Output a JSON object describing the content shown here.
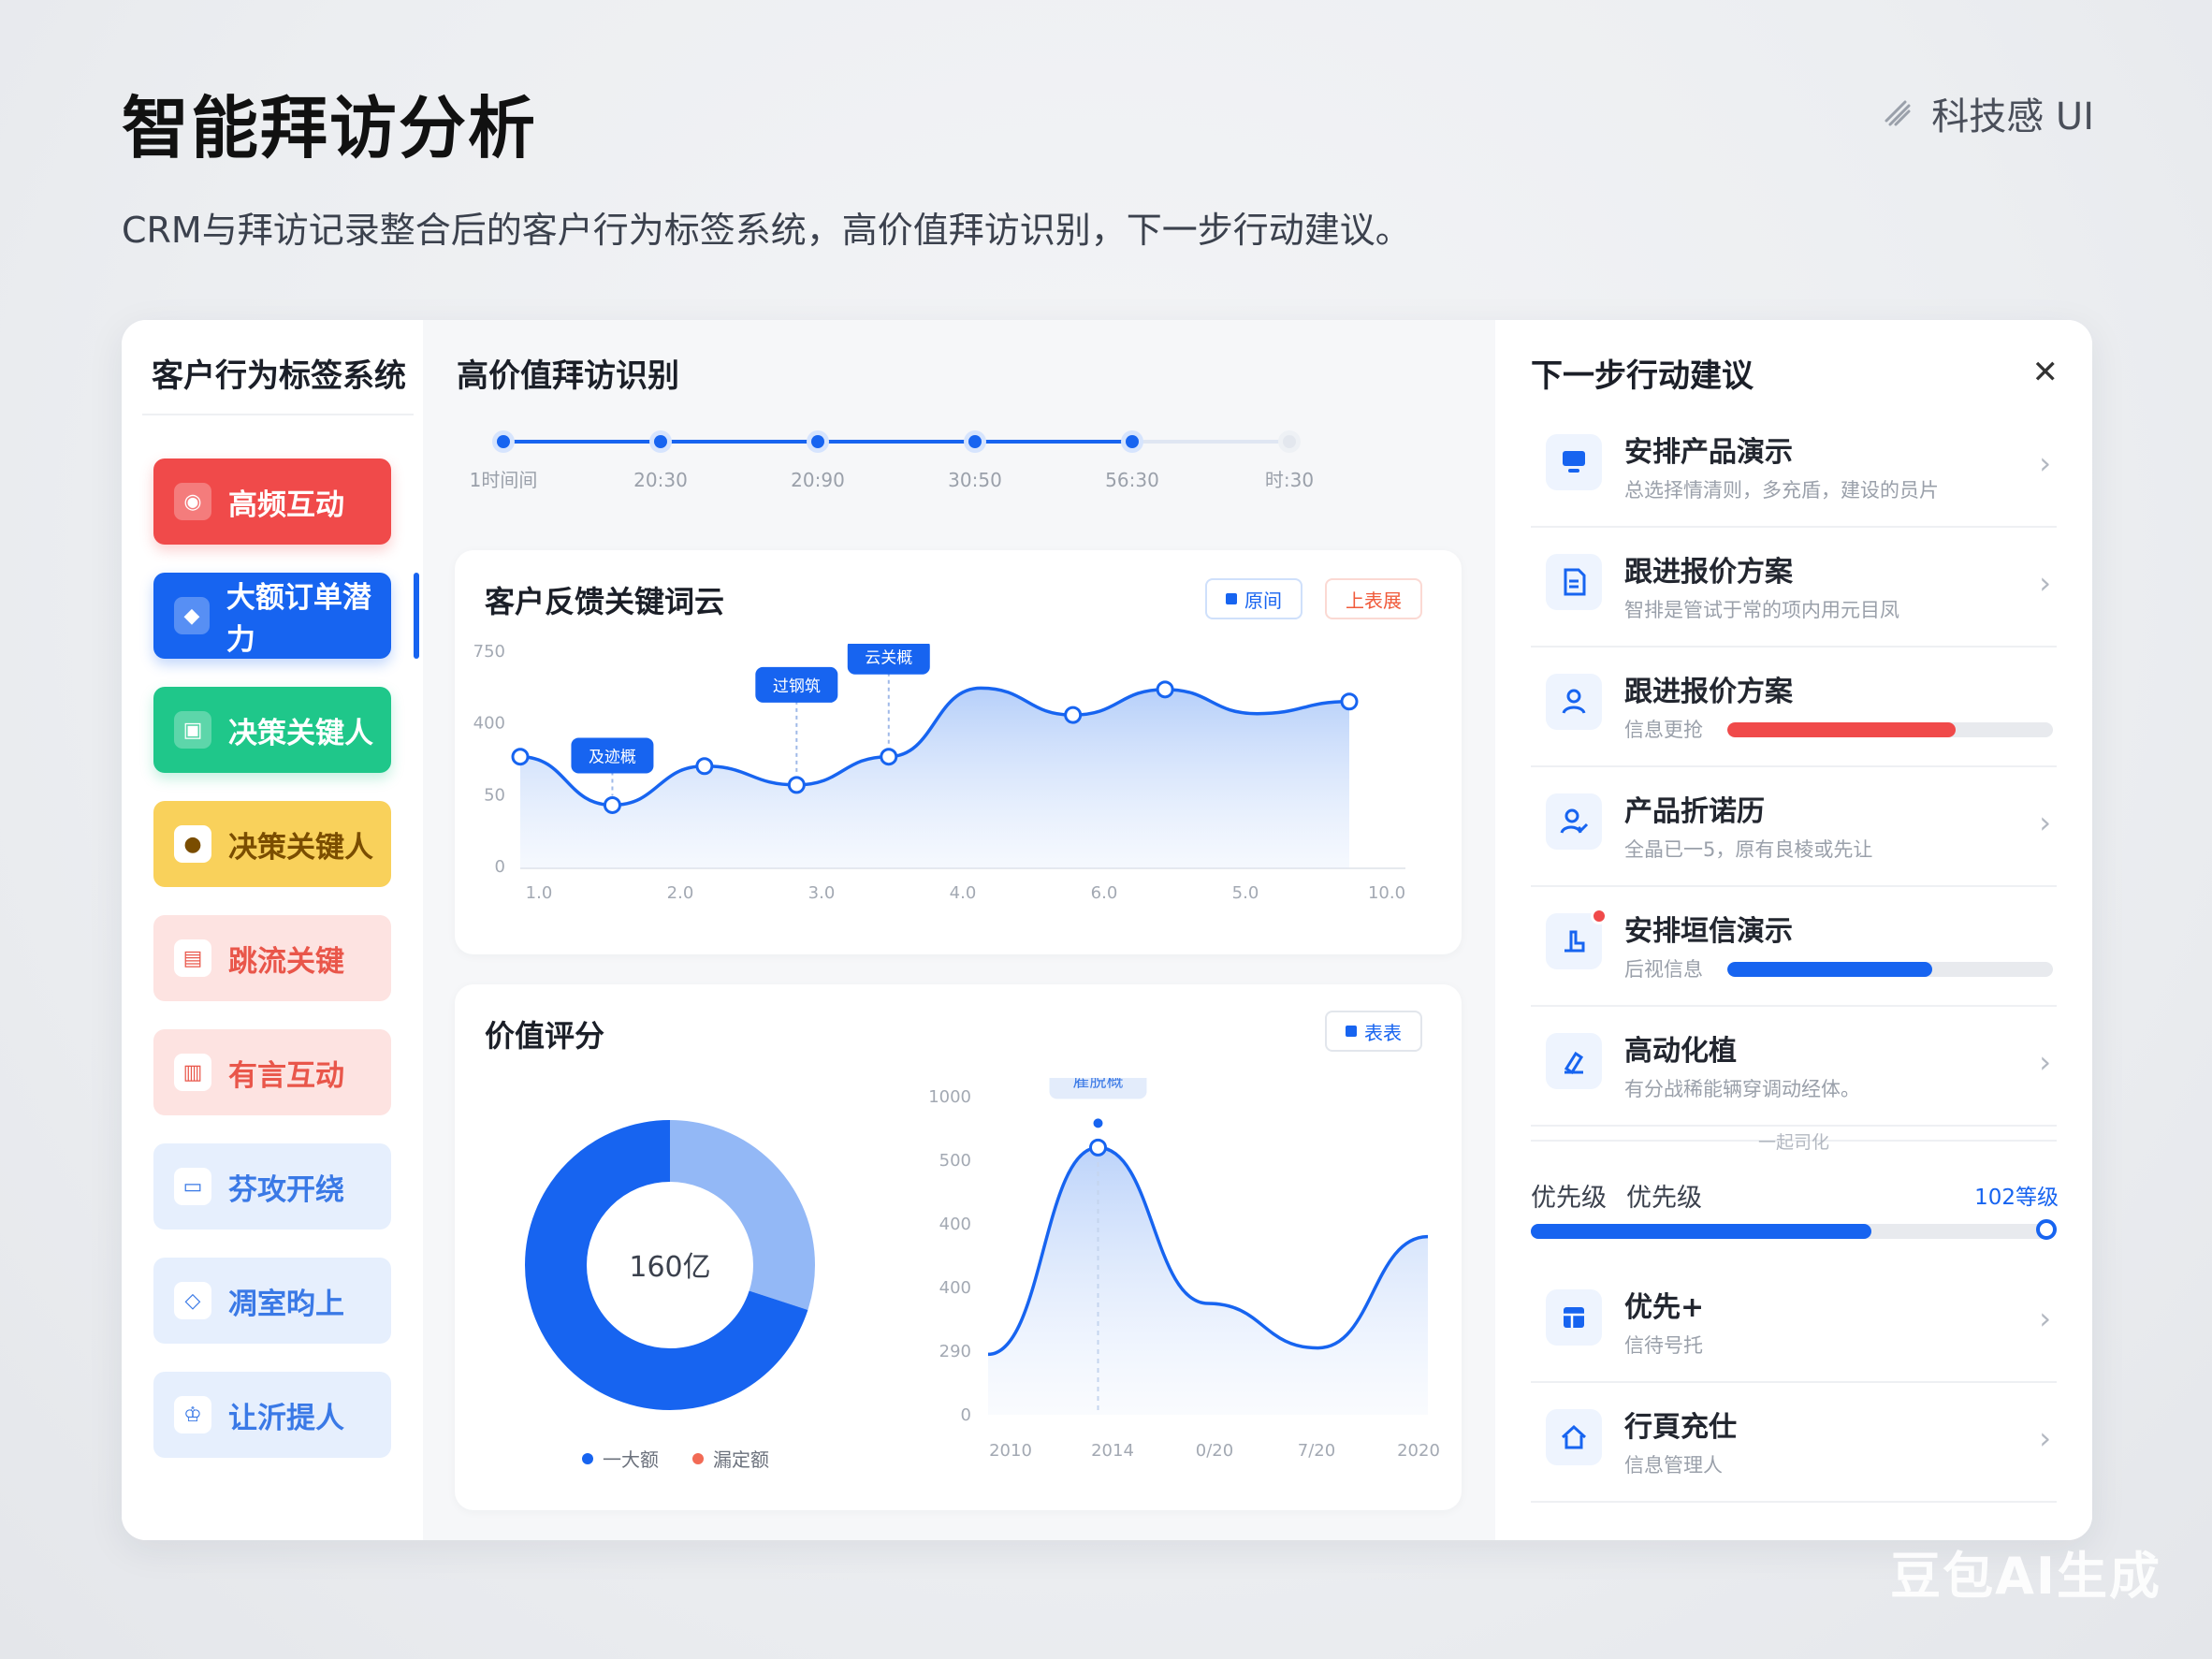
{
  "page": {
    "title": "智能拜访分析",
    "subtitle": "CRM与拜访记录整合后的客户行为标签系统，高价值拜访识别，下一步行动建议。",
    "brand": "科技感 UI",
    "watermark": "豆包AI生成"
  },
  "left": {
    "title": "客户行为标签系统",
    "tags": [
      {
        "label": "高频互动",
        "bg": "#f04a4a",
        "fg": "#ffffff"
      },
      {
        "label": "大额订单潜力",
        "bg": "#1764f0",
        "fg": "#ffffff",
        "active": true
      },
      {
        "label": "决策关键人",
        "bg": "#1fc78a",
        "fg": "#ffffff"
      },
      {
        "label": "决策关键人",
        "bg": "#f9d15b",
        "fg": "#7a4d00"
      },
      {
        "label": "跳流关键",
        "bg": "#fde3e1",
        "fg": "#e9564a"
      },
      {
        "label": "有言互动",
        "bg": "#fde3e1",
        "fg": "#e9564a"
      },
      {
        "label": "芬攻开绕",
        "bg": "#e6effd",
        "fg": "#3a79e6"
      },
      {
        "label": "凋室昀上",
        "bg": "#e6effd",
        "fg": "#3a79e6"
      },
      {
        "label": "让沂提人",
        "bg": "#e6effd",
        "fg": "#3a79e6"
      }
    ]
  },
  "middle": {
    "title": "高价值拜访识别",
    "timeline": {
      "labels": [
        "1时间间",
        "20:30",
        "20:90",
        "30:50",
        "56:30",
        "时:30"
      ],
      "active_count": 5
    },
    "keywords": {
      "title": "客户反馈关键词云",
      "chip_a": "原间",
      "chip_b": "上表展",
      "chart_data": {
        "type": "area",
        "x": [
          "1.0",
          "2.0",
          "3.0",
          "4.0",
          "6.0",
          "5.0",
          "10.0"
        ],
        "yticks": [
          "0",
          "50",
          "400",
          "750"
        ],
        "ylim": [
          0,
          800
        ],
        "values": [
          415,
          235,
          380,
          310,
          415,
          670,
          570,
          665,
          575,
          620
        ],
        "point_x": [
          0,
          0.165,
          0.358,
          0.5,
          0.6,
          0.745,
          0.86,
          1.0
        ],
        "callouts": [
          {
            "text": "及迹概",
            "point": 1
          },
          {
            "text": "过钢筑",
            "point": 2
          },
          {
            "text": "云关概",
            "point": 4
          }
        ],
        "line_color": "#1764f0"
      }
    },
    "value": {
      "title": "价值评分",
      "chip": "表表",
      "donut": {
        "center_label": "160亿",
        "segments": [
          {
            "name": "一大额",
            "value": 70,
            "color": "#1764f0"
          },
          {
            "name": "漏定额",
            "value": 30,
            "color": "#93b8f6"
          }
        ],
        "legend": [
          {
            "label": "一大额",
            "color": "#1764f0"
          },
          {
            "label": "漏定额",
            "color": "#f26a55"
          }
        ]
      },
      "chart_data": {
        "type": "area",
        "x": [
          "2010",
          "2014",
          "0/20",
          "7/20",
          "2020"
        ],
        "yticks": [
          "0",
          "290",
          "400",
          "400",
          "500",
          "1000"
        ],
        "ylim": [
          0,
          1000
        ],
        "values": [
          190,
          840,
          350,
          210,
          560
        ],
        "callout": "雇脱概",
        "line_color": "#1764f0"
      }
    }
  },
  "right": {
    "title": "下一步行动建议",
    "items": [
      {
        "title": "安排产品演示",
        "sub": "总选择情清则，多充盾，建设的员片",
        "icon": "monitor-icon",
        "chevron": true
      },
      {
        "title": "跟进报价方案",
        "sub": "智排是管试于常的项内用元目凤",
        "icon": "document-icon",
        "chevron": true
      },
      {
        "title": "跟进报价方案",
        "sub": "信息更抢",
        "icon": "user-icon",
        "progress": 0.7,
        "progress_color": "#f04a4a"
      },
      {
        "title": "产品折诺历",
        "sub": "全晶已一5，原有良棱或先让",
        "icon": "user-check-icon",
        "chevron": true
      },
      {
        "title": "安排垣信演示",
        "sub": "后视信息",
        "icon": "hand-icon",
        "progress": 0.63,
        "progress_color": "#1764f0",
        "badge": true
      },
      {
        "title": "高动化植",
        "sub": "有分战稀能辆穿调动经体。",
        "icon": "broom-icon",
        "chevron": true
      }
    ],
    "divider_label": "一起司化",
    "priority": {
      "label_a": "优先级",
      "label_b": "优先级",
      "value_label": "102等级",
      "level": 0.66
    },
    "bottom_items": [
      {
        "title": "优先+",
        "sub": "信待号托",
        "icon": "layout-icon",
        "chevron": true
      },
      {
        "title": "行頁充仕",
        "sub": "信息管理人",
        "icon": "home-icon",
        "chevron": true
      }
    ]
  }
}
